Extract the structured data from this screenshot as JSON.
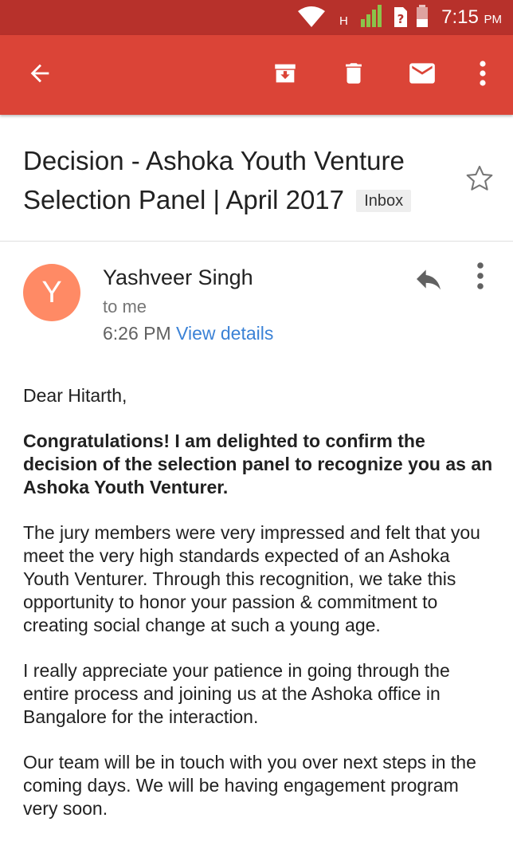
{
  "status_bar": {
    "network_label": "H",
    "time": "7:15",
    "ampm": "PM"
  },
  "toolbar": {
    "icons": [
      "back-arrow-icon",
      "archive-icon",
      "delete-icon",
      "mark-unread-icon",
      "overflow-menu-icon"
    ],
    "background_color": "#db4437",
    "status_color": "#b7312b"
  },
  "email": {
    "subject": "Decision - Ashoka Youth Venture Selection Panel | April 2017",
    "label": "Inbox",
    "sender": {
      "initial": "Y",
      "name": "Yashveer Singh",
      "avatar_color": "#ff8a65"
    },
    "recipient": "to me",
    "time": "6:26 PM",
    "view_details": "View details",
    "body": {
      "greeting": "Dear Hitarth,",
      "highlight": "Congratulations! I am delighted to confirm the decision of the selection panel to recognize you as an Ashoka Youth Venturer.",
      "paragraph_1": "The jury members were very impressed and felt that you meet the very high standards expected of an Ashoka Youth Venturer. Through this recognition, we take this opportunity to honor your passion & commitment to creating social change at such a young age.",
      "paragraph_2": "I really appreciate your patience in going through the entire process and joining us at the Ashoka office in Bangalore for the interaction.",
      "paragraph_3": "Our team will be in touch with you over next steps in the coming days. We will be having engagement program very soon."
    }
  },
  "link_color": "#3b82d6"
}
